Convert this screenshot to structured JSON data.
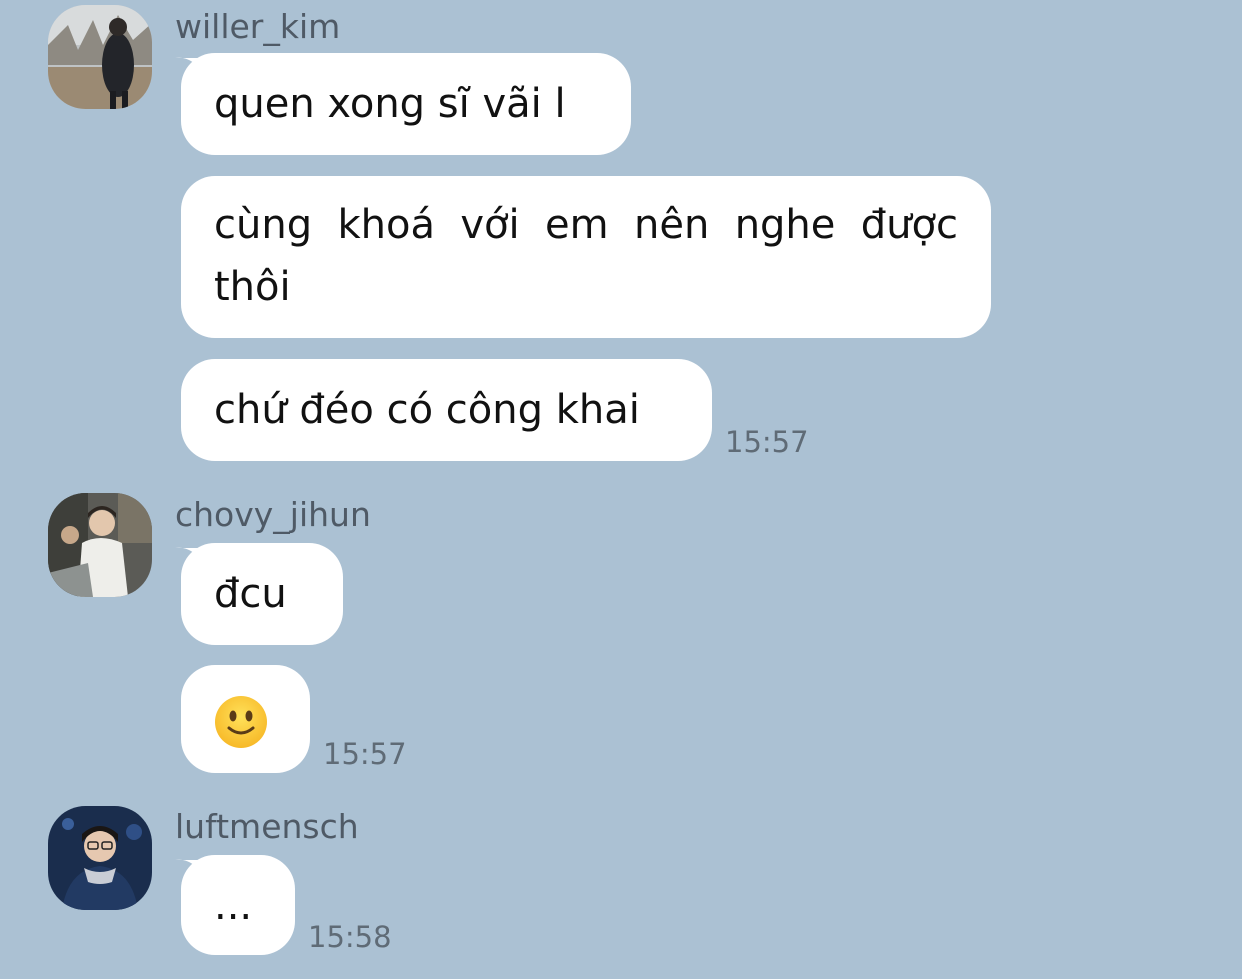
{
  "messages": [
    {
      "sender": "willer_kim",
      "bubbles": [
        "quen xong sĩ vãi l",
        "cùng khoá với em nên nghe được thôi",
        "chứ đéo có công khai"
      ],
      "time": "15:57"
    },
    {
      "sender": "chovy_jihun",
      "bubbles": [
        "đcu",
        "🙂"
      ],
      "time": "15:57"
    },
    {
      "sender": "luftmensch",
      "bubbles": [
        "..."
      ],
      "time": "15:58"
    }
  ],
  "icons": {
    "emoji": "slightly-smiling-face-icon"
  },
  "colors": {
    "background": "#abc1d3",
    "bubble": "#ffffff",
    "sender_text": "#4f5a66",
    "time_text": "#5f6b76"
  }
}
